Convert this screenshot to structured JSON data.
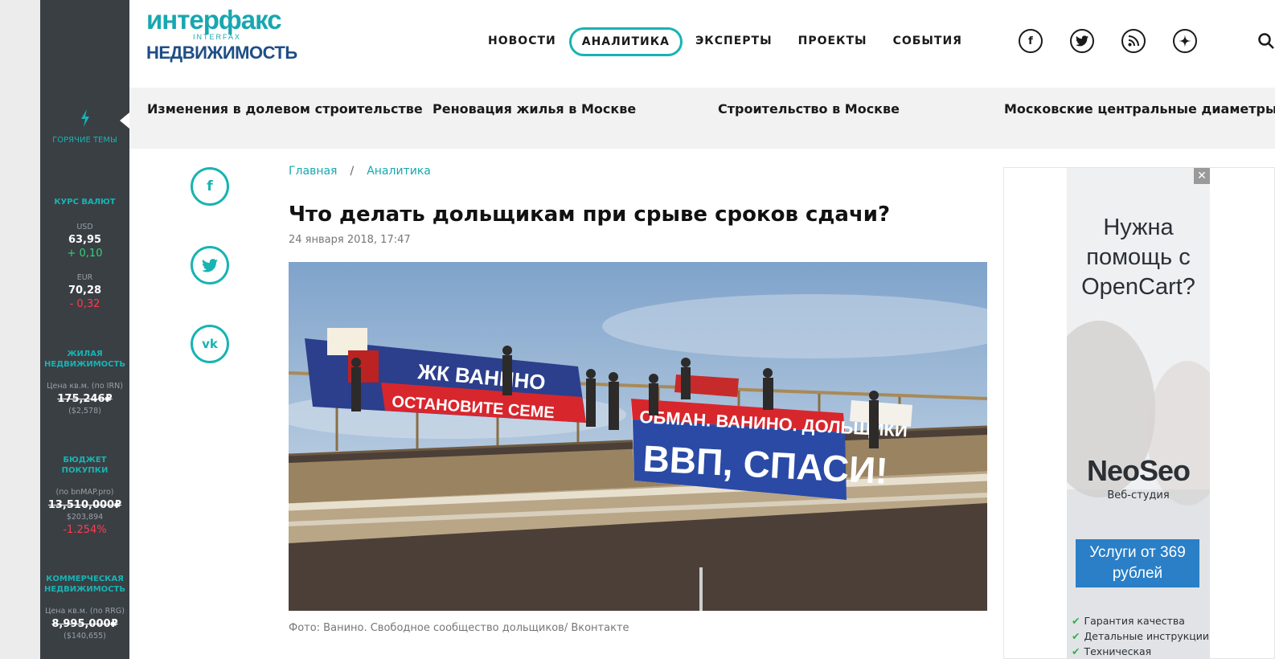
{
  "sidebar": {
    "hot_label": "ГОРЯЧИЕ ТЕМЫ",
    "currency_title": "КУРС ВАЛЮТ",
    "usd_label": "USD",
    "usd_value": "63,95",
    "usd_change": "+ 0,10",
    "eur_label": "EUR",
    "eur_value": "70,28",
    "eur_change": "- 0,32",
    "housing_title": "ЖИЛАЯ НЕДВИЖИМОСТЬ",
    "housing_note": "Цена кв.м. (по IRN)",
    "housing_value": "175,246₽",
    "housing_usd": "($2,578)",
    "budget_title": "БЮДЖЕТ ПОКУПКИ",
    "budget_note": "(по bnMAP.pro)",
    "budget_value": "13,510,000₽",
    "budget_usd": "$203,894",
    "budget_change": "-1.254%",
    "commercial_title": "КОММЕРЧЕСКАЯ НЕДВИЖИМОСТЬ",
    "commercial_note": "Цена кв.м. (по RRG)",
    "commercial_value": "8,995,000₽",
    "commercial_usd": "($140,655)"
  },
  "header": {
    "logo_top": "интерфакс",
    "logo_interfax": "INTERFAX",
    "logo_bottom": "НЕДВИЖИМОСТЬ",
    "nav": [
      "НОВОСТИ",
      "АНАЛИТИКА",
      "ЭКСПЕРТЫ",
      "ПРОЕКТЫ",
      "СОБЫТИЯ"
    ],
    "active_nav": "АНАЛИТИКА",
    "social_icons": [
      "facebook-icon",
      "twitter-icon",
      "rss-icon",
      "zen-icon",
      "search-icon"
    ]
  },
  "topics": [
    "Изменения в долевом строительстве",
    "Реновация жилья в Москве",
    "Строительство в Москве",
    "Московские центральные диаметры"
  ],
  "share_icons": [
    "facebook-icon",
    "twitter-icon",
    "vk-icon"
  ],
  "article": {
    "crumb_home": "Главная",
    "crumb_sep": "/",
    "crumb_section": "Аналитика",
    "title": "Что делать дольщикам при срыве сроков сдачи?",
    "date": "24 января 2018, 17:47",
    "caption": "Фото: Ванино. Свободное сообщество дольщиков/ Вконтакте",
    "photo_banner_1a": "ЖК ВАНИНО",
    "photo_banner_1b": "ОСТАНОВИТЕ СЕМЕ",
    "photo_banner_2a": "ОБМАН. ВАНИНО. ДОЛЬЩИКИ",
    "photo_banner_2b": "ВВП, СПАСИ!"
  },
  "ad": {
    "close": "✕",
    "headline": "Нужна помощь с OpenCart?",
    "brand": "NeoSeo",
    "sub": "Веб-студия",
    "button": "Услуги от 369 рублей",
    "features": [
      "Гарантия качества",
      "Детальные инструкции",
      "Техническая поддержка"
    ]
  },
  "colors": {
    "accent": "#18b3b3",
    "sidebar_bg": "#3a3f44",
    "up": "#33d17a",
    "down": "#ff3b4e",
    "logo_blue": "#1e4e86"
  }
}
